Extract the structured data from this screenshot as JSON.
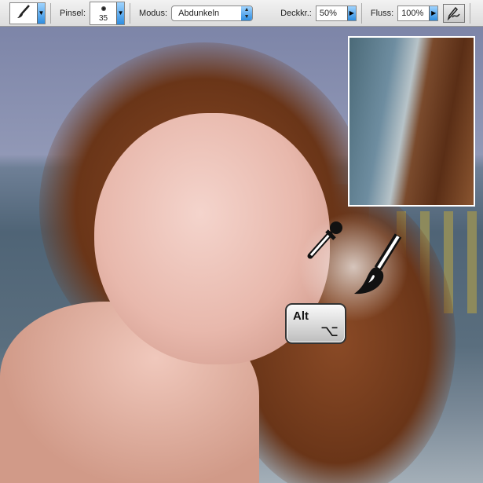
{
  "toolbar": {
    "tool_icon": "brush-icon",
    "brush_label": "Pinsel:",
    "brush_size": "35",
    "mode_label": "Modus:",
    "mode_value": "Abdunkeln",
    "opacity_label": "Deckkr.:",
    "opacity_value": "50%",
    "flow_label": "Fluss:",
    "flow_value": "100%",
    "airbrush_icon": "airbrush-icon"
  },
  "overlay": {
    "key_label": "Alt",
    "key_symbol": "⌥",
    "icons": [
      "eyedropper-icon",
      "brush-icon"
    ]
  }
}
